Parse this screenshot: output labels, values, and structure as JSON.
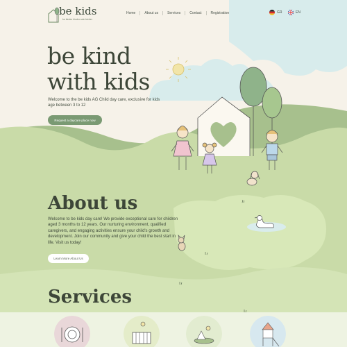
{
  "header": {
    "logo_text": "be kids",
    "logo_tagline": "be kinder kinder sein bieber",
    "nav": [
      "Home",
      "About us",
      "Services",
      "Contact",
      "Registration"
    ],
    "languages": [
      {
        "code": "GR",
        "icon": "flag-germany-icon"
      },
      {
        "code": "EN",
        "icon": "flag-uk-icon"
      }
    ]
  },
  "hero": {
    "title_line1": "be kind",
    "title_line2": "with kids",
    "description": "Welcome to the be kids AG Child day care, exclusive for kids age between 3 to 12",
    "cta_label": "Request a daycare place now"
  },
  "about": {
    "title": "About us",
    "text": "Welcome to be kids day care! We provide exceptional care for children aged 3 months to 12 years. Our nurturing environment, qualified caregivers, and engaging activities ensure your child's growth and development. Join our community and give your child the best start in life. Visit us today!",
    "cta_label": "Learn More About Us"
  },
  "services": {
    "title": "Services",
    "icons": [
      "meals-icon",
      "crib-icon",
      "nature-icon",
      "playground-icon"
    ]
  },
  "colors": {
    "accent_green": "#7a9a73",
    "text_dark": "#3d4638",
    "bg_green": "#c9dba8",
    "sky_blue": "#d8ecec",
    "cream": "#f6f2e9"
  }
}
